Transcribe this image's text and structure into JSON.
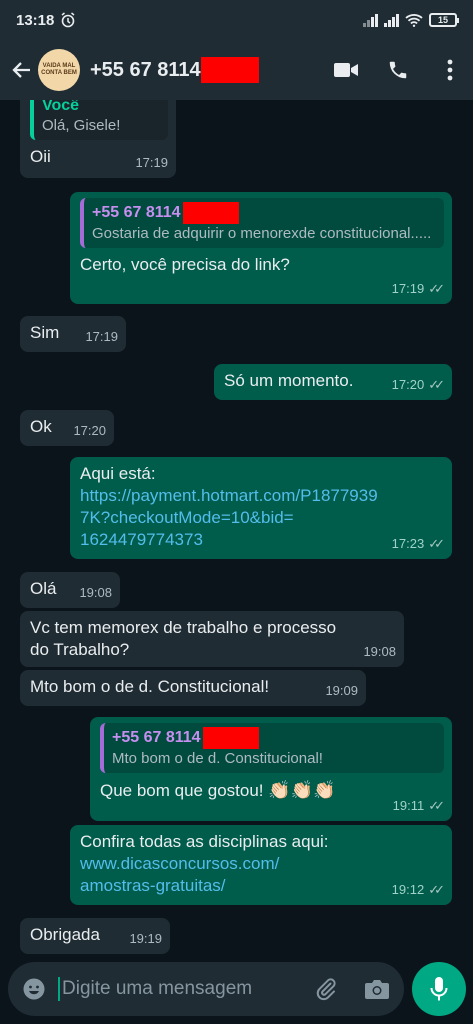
{
  "status": {
    "time": "13:18",
    "battery": "15"
  },
  "header": {
    "avatar_text": "VAIDA MAL CONTA BEM",
    "contact_prefix": "+55 67 8114"
  },
  "messages": [
    {
      "dir": "in",
      "quote_name": "Você",
      "quote_text": "Olá, Gisele!",
      "text": "Oii",
      "time": "17:19"
    },
    {
      "dir": "out",
      "quote_name": "+55 67 8114",
      "quote_text": "Gostaria de adquirir o menorexde constitucional.....",
      "text": "Certo, você precisa do link?",
      "time": "17:19"
    },
    {
      "dir": "in",
      "text": "Sim",
      "time": "17:19"
    },
    {
      "dir": "out",
      "text": "Só um momento.",
      "time": "17:20"
    },
    {
      "dir": "in",
      "text": "Ok",
      "time": "17:20"
    },
    {
      "dir": "out",
      "text": "Aqui está:",
      "link": "https://payment.hotmart.com/P18779397K?checkoutMode=10&bid=1624479774373",
      "link_lines": [
        "https://payment.hotmart.com/P1877939",
        "7K?checkoutMode=10&bid=",
        "1624479774373"
      ],
      "time": "17:23"
    },
    {
      "dir": "in",
      "text": "Olá",
      "time": "19:08"
    },
    {
      "dir": "in",
      "text_lines": [
        "Vc tem memorex de trabalho e processo",
        "do Trabalho?"
      ],
      "time": "19:08"
    },
    {
      "dir": "in",
      "text": "Mto bom o de d. Constitucional!",
      "time": "19:09"
    },
    {
      "dir": "out",
      "quote_name": "+55 67 8114",
      "quote_text": "Mto bom o de d. Constitucional!",
      "text": "Que bom que gostou!",
      "emoji": "👏🏻👏🏻👏🏻",
      "time": "19:11"
    },
    {
      "dir": "out",
      "text": "Confira todas as disciplinas aqui:",
      "link_lines": [
        "www.dicasconcursos.com/",
        "amostras-gratuitas/"
      ],
      "time": "19:12"
    },
    {
      "dir": "in",
      "text": "Obrigada",
      "time": "19:19"
    }
  ],
  "input": {
    "placeholder": "Digite uma mensagem"
  },
  "colors": {
    "background": "#0b141a",
    "incoming": "#202c33",
    "outgoing": "#005c4b",
    "accent": "#00a884",
    "redaction": "#ff0000"
  },
  "icons": [
    "alarm-icon",
    "signal-icon",
    "wifi-icon",
    "battery-icon",
    "back-arrow-icon",
    "video-call-icon",
    "phone-icon",
    "more-vert-icon",
    "emoji-icon",
    "attach-icon",
    "camera-icon",
    "mic-icon",
    "double-check-icon"
  ]
}
